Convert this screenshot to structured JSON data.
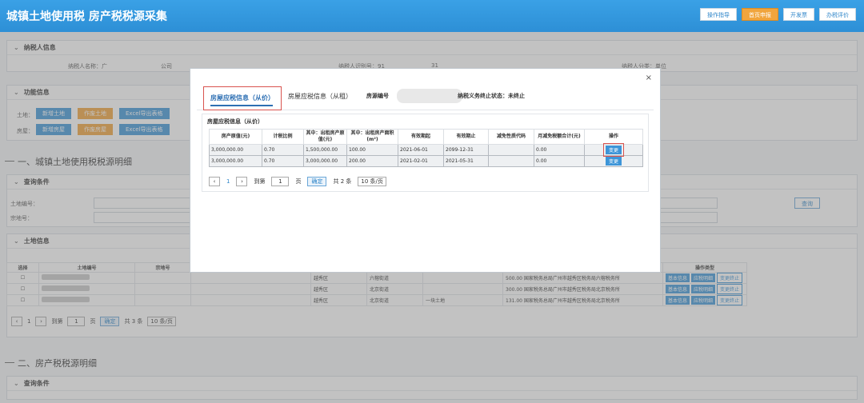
{
  "header": {
    "title": "城镇土地使用税 房产税税源采集",
    "buttons": [
      "操作指导",
      "首页申报",
      "开发票",
      "办税评价"
    ],
    "active_index": 1
  },
  "taxpayer": {
    "section_title": "纳税人信息",
    "name_label": "纳税人名称：广",
    "name_suffix": "公司",
    "id_label": "纳税人识别号：91",
    "id_suffix": "31",
    "type_label": "纳税人分类：单位"
  },
  "functions": {
    "section_title": "功能信息",
    "land_label": "土地：",
    "house_label": "房屋：",
    "land_buttons": [
      "新增土地",
      "作废土地",
      "Excel导出表格"
    ],
    "house_buttons": [
      "新增房屋",
      "作废房屋",
      "Excel导出表格"
    ]
  },
  "section1_title": "一、城镇土地使用税税源明细",
  "query": {
    "section_title": "查询条件",
    "land_no_label": "土地编号：",
    "parcel_label": "宗地号：",
    "query_button": "查询"
  },
  "land_info": {
    "section_title": "土地信息",
    "columns": [
      "选择",
      "土地编号",
      "宗地号",
      "操作类型"
    ],
    "rows": [
      {
        "district": "越秀区",
        "street": "六榕街道",
        "name": "",
        "amount": "500.00",
        "office": "国家税务总局广州市越秀区税务局六榕税务所"
      },
      {
        "district": "越秀区",
        "street": "北京街道",
        "name": "",
        "amount": "300.00",
        "office": "国家税务总局广州市越秀区税务局北京税务所"
      },
      {
        "district": "越秀区",
        "street": "北京街道",
        "name": "一块土地",
        "amount": "131.00",
        "office": "国家税务总局广州市越秀区税务局北京税务所"
      }
    ],
    "row_buttons": [
      "基本信息",
      "应税明细",
      "变更终止"
    ],
    "pager": {
      "page": "1",
      "goto_label": "到第",
      "goto_value": "1",
      "page_unit": "页",
      "confirm": "确定",
      "total": "共 3 条",
      "page_size": "10 条/页"
    }
  },
  "section2_title": "二、房产税税源明细",
  "query2_title": "查询条件",
  "modal": {
    "close": "×",
    "tabs": [
      "房屋应税信息（从价）",
      "房屋应税信息（从租）"
    ],
    "active_tab": 0,
    "house_no_label": "房源编号",
    "tax_end_status": "纳税义务终止状态：未终止",
    "inner_title": "房屋应税信息（从价）",
    "columns": [
      "房产原值(元)",
      "计税比例",
      "其中：出租房产原值(元)",
      "其中：出租房产面积(m²)",
      "有效期起",
      "有效期止",
      "减免性质代码",
      "月减免税额合计(元)",
      "操作"
    ],
    "rows": [
      {
        "original_value": "3,000,000.00",
        "ratio": "0.70",
        "rent_value": "1,500,000.00",
        "rent_area": "100.00",
        "start": "2021-06-01",
        "end": "2099-12-31",
        "code": "",
        "relief": "0.00",
        "op": "变更"
      },
      {
        "original_value": "3,000,000.00",
        "ratio": "0.70",
        "rent_value": "3,000,000.00",
        "rent_area": "200.00",
        "start": "2021-02-01",
        "end": "2021-05-31",
        "code": "",
        "relief": "0.00",
        "op": "变更"
      }
    ],
    "pager": {
      "page": "1",
      "goto_label": "到第",
      "goto_value": "1",
      "page_unit": "页",
      "confirm": "确定",
      "total": "共 2 条",
      "page_size": "10 条/页"
    }
  },
  "colors": {
    "header": "#2d8fd6",
    "accent_orange": "#f0a23a",
    "highlight_red": "#d9534f",
    "link_blue": "#2d6fb3"
  }
}
